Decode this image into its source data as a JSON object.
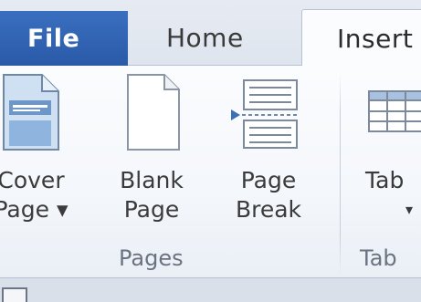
{
  "tabs": {
    "file": "File",
    "home": "Home",
    "insert": "Insert"
  },
  "ribbon": {
    "commands": {
      "cover_page": {
        "line1": "Cover",
        "line2": "Page ▾",
        "icon": "cover-page-icon"
      },
      "blank_page": {
        "line1": "Blank",
        "line2": "Page",
        "icon": "blank-page-icon"
      },
      "page_break": {
        "line1": "Page",
        "line2": "Break",
        "icon": "page-break-icon"
      },
      "table": {
        "line1": "Tab",
        "line2": "▾",
        "icon": "table-icon"
      }
    },
    "groups": {
      "pages": "Pages",
      "tables": "Tab"
    }
  },
  "colors": {
    "file_tab": "#2a5aa8",
    "accent_border": "#b6c2d4",
    "group_label": "#6b7280"
  }
}
